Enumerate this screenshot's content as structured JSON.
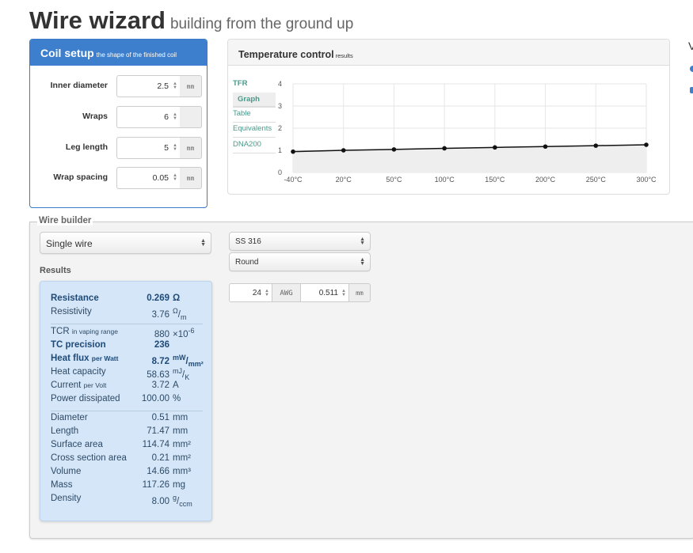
{
  "header": {
    "title": "Wire wizard",
    "subtitle": "building from the ground up"
  },
  "coil_setup": {
    "title": "Coil setup",
    "subtitle": "the shape of the finished coil",
    "fields": [
      {
        "label": "Inner diameter",
        "value": "2.5",
        "unit": "mm"
      },
      {
        "label": "Wraps",
        "value": "6",
        "unit": ""
      },
      {
        "label": "Leg length",
        "value": "5",
        "unit": "mm"
      },
      {
        "label": "Wrap spacing",
        "value": "0.05",
        "unit": "mm"
      }
    ]
  },
  "temperature_control": {
    "title": "Temperature control",
    "subtitle": "results",
    "nav": {
      "tfr": "TFR",
      "graph": "Graph",
      "table": "Table",
      "equivalents": "Equivalents",
      "dna200": "DNA200"
    }
  },
  "chart_data": {
    "type": "line",
    "categories": [
      "-40°C",
      "20°C",
      "50°C",
      "100°C",
      "150°C",
      "200°C",
      "250°C",
      "300°C"
    ],
    "series": [
      {
        "values": [
          0.94,
          1.0,
          1.04,
          1.09,
          1.13,
          1.17,
          1.21,
          1.25
        ]
      }
    ],
    "yticks": [
      "0",
      "1",
      "2",
      "3",
      "4"
    ],
    "ylim": [
      0,
      4
    ],
    "grid": true,
    "colors": {
      "line": "#111111",
      "area": "#eeeeee",
      "grid": "#e6e6e6"
    }
  },
  "wire_builder": {
    "legend": "Wire builder",
    "wire_type": "Single wire",
    "material": "SS 316",
    "shape": "Round",
    "gauge": {
      "awg_value": "24",
      "awg_unit": "AWG",
      "mm_value": "0.511",
      "mm_unit": "mm"
    },
    "results_label": "Results",
    "results": {
      "resistance": {
        "label": "Resistance",
        "value": "0.269",
        "unit": "Ω"
      },
      "resistivity": {
        "label": "Resistivity",
        "value": "3.76",
        "unit_num": "Ω",
        "unit_den": "m"
      },
      "tcr": {
        "label": "TCR",
        "label_small": "in vaping range",
        "value": "880",
        "unit": "×10",
        "unit_sup": "-6"
      },
      "tc_precision": {
        "label": "TC precision",
        "value": "236"
      },
      "heat_flux": {
        "label": "Heat flux",
        "label_small": "per Watt",
        "value": "8.72",
        "unit_num": "mW",
        "unit_den": "mm²"
      },
      "heat_capacity": {
        "label": "Heat capacity",
        "value": "58.63",
        "unit_num": "mJ",
        "unit_den": "K"
      },
      "current": {
        "label": "Current",
        "label_small": "per Volt",
        "value": "3.72",
        "unit": "A"
      },
      "power_dissipated": {
        "label": "Power dissipated",
        "value": "100.00",
        "unit": "%"
      },
      "diameter": {
        "label": "Diameter",
        "value": "0.51",
        "unit": "mm"
      },
      "length": {
        "label": "Length",
        "value": "71.47",
        "unit": "mm"
      },
      "surface_area": {
        "label": "Surface area",
        "value": "114.74",
        "unit": "mm²"
      },
      "cross_section": {
        "label": "Cross section area",
        "value": "0.21",
        "unit": "mm²"
      },
      "volume": {
        "label": "Volume",
        "value": "14.66",
        "unit": "mm³"
      },
      "mass": {
        "label": "Mass",
        "value": "117.26",
        "unit": "mg"
      },
      "density": {
        "label": "Density",
        "value": "8.00",
        "unit_num": "g",
        "unit_den": "ccm"
      }
    }
  },
  "right_edge": {
    "fragment": "V"
  }
}
